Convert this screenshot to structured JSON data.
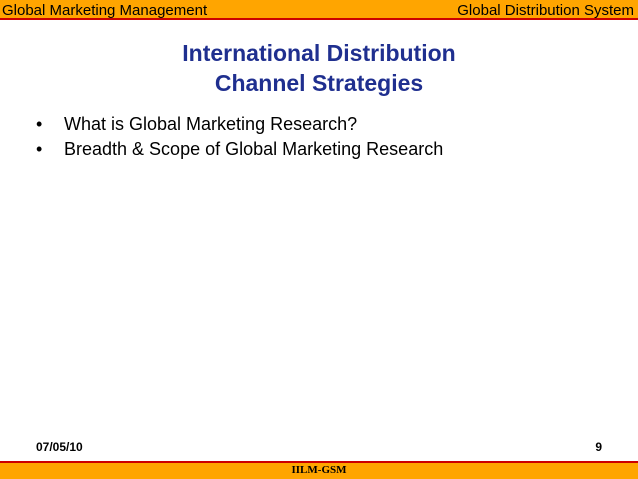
{
  "header": {
    "left_text": "Global  Marketing Management",
    "right_text": "Global Distribution System"
  },
  "title": {
    "line1": "International Distribution",
    "line2": "Channel Strategies"
  },
  "bullets": [
    "What is Global Marketing Research?",
    "Breadth & Scope of Global Marketing Research"
  ],
  "footer": {
    "date": "07/05/10",
    "page_number": "9",
    "center_text": "IILM-GSM"
  },
  "colors": {
    "bar_background": "#ffa500",
    "bar_border": "#cc0000",
    "title_color": "#1f2f8f"
  }
}
